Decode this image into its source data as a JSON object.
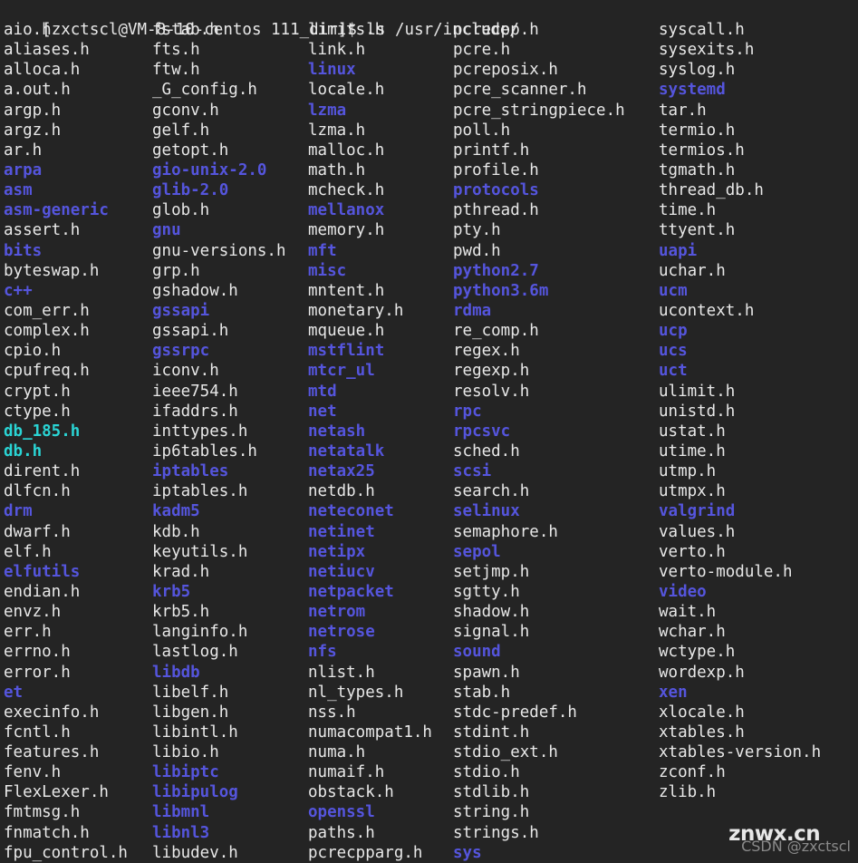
{
  "terminal": {
    "background_color": "#242424",
    "foreground_color": "#e8e8e8",
    "dir_color": "#5555dd",
    "link_color": "#2ad4d4",
    "prompt": {
      "user_host": "[zxctscl@VM-8-10-centos 111_dir]$",
      "command": "ls /usr/include/",
      "full": "[zxctscl@VM-8-10-centos 111_dir]$ ls /usr/include/"
    }
  },
  "watermark": {
    "main": "znwx.cn",
    "sub": "CSDN @zxctscl"
  },
  "listing": {
    "columns": [
      {
        "index": 1,
        "entries": [
          {
            "name": "aio.h",
            "type": "file"
          },
          {
            "name": "aliases.h",
            "type": "file"
          },
          {
            "name": "alloca.h",
            "type": "file"
          },
          {
            "name": "a.out.h",
            "type": "file"
          },
          {
            "name": "argp.h",
            "type": "file"
          },
          {
            "name": "argz.h",
            "type": "file"
          },
          {
            "name": "ar.h",
            "type": "file"
          },
          {
            "name": "arpa",
            "type": "dir"
          },
          {
            "name": "asm",
            "type": "dir"
          },
          {
            "name": "asm-generic",
            "type": "dir"
          },
          {
            "name": "assert.h",
            "type": "file"
          },
          {
            "name": "bits",
            "type": "dir"
          },
          {
            "name": "byteswap.h",
            "type": "file"
          },
          {
            "name": "c++",
            "type": "dir"
          },
          {
            "name": "com_err.h",
            "type": "file"
          },
          {
            "name": "complex.h",
            "type": "file"
          },
          {
            "name": "cpio.h",
            "type": "file"
          },
          {
            "name": "cpufreq.h",
            "type": "file"
          },
          {
            "name": "crypt.h",
            "type": "file"
          },
          {
            "name": "ctype.h",
            "type": "file"
          },
          {
            "name": "db_185.h",
            "type": "link"
          },
          {
            "name": "db.h",
            "type": "link"
          },
          {
            "name": "dirent.h",
            "type": "file"
          },
          {
            "name": "dlfcn.h",
            "type": "file"
          },
          {
            "name": "drm",
            "type": "dir"
          },
          {
            "name": "dwarf.h",
            "type": "file"
          },
          {
            "name": "elf.h",
            "type": "file"
          },
          {
            "name": "elfutils",
            "type": "dir"
          },
          {
            "name": "endian.h",
            "type": "file"
          },
          {
            "name": "envz.h",
            "type": "file"
          },
          {
            "name": "err.h",
            "type": "file"
          },
          {
            "name": "errno.h",
            "type": "file"
          },
          {
            "name": "error.h",
            "type": "file"
          },
          {
            "name": "et",
            "type": "dir"
          },
          {
            "name": "execinfo.h",
            "type": "file"
          },
          {
            "name": "fcntl.h",
            "type": "file"
          },
          {
            "name": "features.h",
            "type": "file"
          },
          {
            "name": "fenv.h",
            "type": "file"
          },
          {
            "name": "FlexLexer.h",
            "type": "file"
          },
          {
            "name": "fmtmsg.h",
            "type": "file"
          },
          {
            "name": "fnmatch.h",
            "type": "file"
          },
          {
            "name": "fpu_control.h",
            "type": "file"
          }
        ]
      },
      {
        "index": 2,
        "entries": [
          {
            "name": "fstab.h",
            "type": "file"
          },
          {
            "name": "fts.h",
            "type": "file"
          },
          {
            "name": "ftw.h",
            "type": "file"
          },
          {
            "name": "_G_config.h",
            "type": "file"
          },
          {
            "name": "gconv.h",
            "type": "file"
          },
          {
            "name": "gelf.h",
            "type": "file"
          },
          {
            "name": "getopt.h",
            "type": "file"
          },
          {
            "name": "gio-unix-2.0",
            "type": "dir"
          },
          {
            "name": "glib-2.0",
            "type": "dir"
          },
          {
            "name": "glob.h",
            "type": "file"
          },
          {
            "name": "gnu",
            "type": "dir"
          },
          {
            "name": "gnu-versions.h",
            "type": "file"
          },
          {
            "name": "grp.h",
            "type": "file"
          },
          {
            "name": "gshadow.h",
            "type": "file"
          },
          {
            "name": "gssapi",
            "type": "dir"
          },
          {
            "name": "gssapi.h",
            "type": "file"
          },
          {
            "name": "gssrpc",
            "type": "dir"
          },
          {
            "name": "iconv.h",
            "type": "file"
          },
          {
            "name": "ieee754.h",
            "type": "file"
          },
          {
            "name": "ifaddrs.h",
            "type": "file"
          },
          {
            "name": "inttypes.h",
            "type": "file"
          },
          {
            "name": "ip6tables.h",
            "type": "file"
          },
          {
            "name": "iptables",
            "type": "dir"
          },
          {
            "name": "iptables.h",
            "type": "file"
          },
          {
            "name": "kadm5",
            "type": "dir"
          },
          {
            "name": "kdb.h",
            "type": "file"
          },
          {
            "name": "keyutils.h",
            "type": "file"
          },
          {
            "name": "krad.h",
            "type": "file"
          },
          {
            "name": "krb5",
            "type": "dir"
          },
          {
            "name": "krb5.h",
            "type": "file"
          },
          {
            "name": "langinfo.h",
            "type": "file"
          },
          {
            "name": "lastlog.h",
            "type": "file"
          },
          {
            "name": "libdb",
            "type": "dir"
          },
          {
            "name": "libelf.h",
            "type": "file"
          },
          {
            "name": "libgen.h",
            "type": "file"
          },
          {
            "name": "libintl.h",
            "type": "file"
          },
          {
            "name": "libio.h",
            "type": "file"
          },
          {
            "name": "libiptc",
            "type": "dir"
          },
          {
            "name": "libipulog",
            "type": "dir"
          },
          {
            "name": "libmnl",
            "type": "dir"
          },
          {
            "name": "libnl3",
            "type": "dir"
          },
          {
            "name": "libudev.h",
            "type": "file"
          }
        ]
      },
      {
        "index": 3,
        "entries": [
          {
            "name": "limits.h",
            "type": "file"
          },
          {
            "name": "link.h",
            "type": "file"
          },
          {
            "name": "linux",
            "type": "dir"
          },
          {
            "name": "locale.h",
            "type": "file"
          },
          {
            "name": "lzma",
            "type": "dir"
          },
          {
            "name": "lzma.h",
            "type": "file"
          },
          {
            "name": "malloc.h",
            "type": "file"
          },
          {
            "name": "math.h",
            "type": "file"
          },
          {
            "name": "mcheck.h",
            "type": "file"
          },
          {
            "name": "mellanox",
            "type": "dir"
          },
          {
            "name": "memory.h",
            "type": "file"
          },
          {
            "name": "mft",
            "type": "dir"
          },
          {
            "name": "misc",
            "type": "dir"
          },
          {
            "name": "mntent.h",
            "type": "file"
          },
          {
            "name": "monetary.h",
            "type": "file"
          },
          {
            "name": "mqueue.h",
            "type": "file"
          },
          {
            "name": "mstflint",
            "type": "dir"
          },
          {
            "name": "mtcr_ul",
            "type": "dir"
          },
          {
            "name": "mtd",
            "type": "dir"
          },
          {
            "name": "net",
            "type": "dir"
          },
          {
            "name": "netash",
            "type": "dir"
          },
          {
            "name": "netatalk",
            "type": "dir"
          },
          {
            "name": "netax25",
            "type": "dir"
          },
          {
            "name": "netdb.h",
            "type": "file"
          },
          {
            "name": "neteconet",
            "type": "dir"
          },
          {
            "name": "netinet",
            "type": "dir"
          },
          {
            "name": "netipx",
            "type": "dir"
          },
          {
            "name": "netiucv",
            "type": "dir"
          },
          {
            "name": "netpacket",
            "type": "dir"
          },
          {
            "name": "netrom",
            "type": "dir"
          },
          {
            "name": "netrose",
            "type": "dir"
          },
          {
            "name": "nfs",
            "type": "dir"
          },
          {
            "name": "nlist.h",
            "type": "file"
          },
          {
            "name": "nl_types.h",
            "type": "file"
          },
          {
            "name": "nss.h",
            "type": "file"
          },
          {
            "name": "numacompat1.h",
            "type": "file"
          },
          {
            "name": "numa.h",
            "type": "file"
          },
          {
            "name": "numaif.h",
            "type": "file"
          },
          {
            "name": "obstack.h",
            "type": "file"
          },
          {
            "name": "openssl",
            "type": "dir"
          },
          {
            "name": "paths.h",
            "type": "file"
          },
          {
            "name": "pcrecpparg.h",
            "type": "file"
          }
        ]
      },
      {
        "index": 4,
        "entries": [
          {
            "name": "pcrecpp.h",
            "type": "file"
          },
          {
            "name": "pcre.h",
            "type": "file"
          },
          {
            "name": "pcreposix.h",
            "type": "file"
          },
          {
            "name": "pcre_scanner.h",
            "type": "file"
          },
          {
            "name": "pcre_stringpiece.h",
            "type": "file"
          },
          {
            "name": "poll.h",
            "type": "file"
          },
          {
            "name": "printf.h",
            "type": "file"
          },
          {
            "name": "profile.h",
            "type": "file"
          },
          {
            "name": "protocols",
            "type": "dir"
          },
          {
            "name": "pthread.h",
            "type": "file"
          },
          {
            "name": "pty.h",
            "type": "file"
          },
          {
            "name": "pwd.h",
            "type": "file"
          },
          {
            "name": "python2.7",
            "type": "dir"
          },
          {
            "name": "python3.6m",
            "type": "dir"
          },
          {
            "name": "rdma",
            "type": "dir"
          },
          {
            "name": "re_comp.h",
            "type": "file"
          },
          {
            "name": "regex.h",
            "type": "file"
          },
          {
            "name": "regexp.h",
            "type": "file"
          },
          {
            "name": "resolv.h",
            "type": "file"
          },
          {
            "name": "rpc",
            "type": "dir"
          },
          {
            "name": "rpcsvc",
            "type": "dir"
          },
          {
            "name": "sched.h",
            "type": "file"
          },
          {
            "name": "scsi",
            "type": "dir"
          },
          {
            "name": "search.h",
            "type": "file"
          },
          {
            "name": "selinux",
            "type": "dir"
          },
          {
            "name": "semaphore.h",
            "type": "file"
          },
          {
            "name": "sepol",
            "type": "dir"
          },
          {
            "name": "setjmp.h",
            "type": "file"
          },
          {
            "name": "sgtty.h",
            "type": "file"
          },
          {
            "name": "shadow.h",
            "type": "file"
          },
          {
            "name": "signal.h",
            "type": "file"
          },
          {
            "name": "sound",
            "type": "dir"
          },
          {
            "name": "spawn.h",
            "type": "file"
          },
          {
            "name": "stab.h",
            "type": "file"
          },
          {
            "name": "stdc-predef.h",
            "type": "file"
          },
          {
            "name": "stdint.h",
            "type": "file"
          },
          {
            "name": "stdio_ext.h",
            "type": "file"
          },
          {
            "name": "stdio.h",
            "type": "file"
          },
          {
            "name": "stdlib.h",
            "type": "file"
          },
          {
            "name": "string.h",
            "type": "file"
          },
          {
            "name": "strings.h",
            "type": "file"
          },
          {
            "name": "sys",
            "type": "dir"
          }
        ]
      },
      {
        "index": 5,
        "entries": [
          {
            "name": "syscall.h",
            "type": "file"
          },
          {
            "name": "sysexits.h",
            "type": "file"
          },
          {
            "name": "syslog.h",
            "type": "file"
          },
          {
            "name": "systemd",
            "type": "dir"
          },
          {
            "name": "tar.h",
            "type": "file"
          },
          {
            "name": "termio.h",
            "type": "file"
          },
          {
            "name": "termios.h",
            "type": "file"
          },
          {
            "name": "tgmath.h",
            "type": "file"
          },
          {
            "name": "thread_db.h",
            "type": "file"
          },
          {
            "name": "time.h",
            "type": "file"
          },
          {
            "name": "ttyent.h",
            "type": "file"
          },
          {
            "name": "uapi",
            "type": "dir"
          },
          {
            "name": "uchar.h",
            "type": "file"
          },
          {
            "name": "ucm",
            "type": "dir"
          },
          {
            "name": "ucontext.h",
            "type": "file"
          },
          {
            "name": "ucp",
            "type": "dir"
          },
          {
            "name": "ucs",
            "type": "dir"
          },
          {
            "name": "uct",
            "type": "dir"
          },
          {
            "name": "ulimit.h",
            "type": "file"
          },
          {
            "name": "unistd.h",
            "type": "file"
          },
          {
            "name": "ustat.h",
            "type": "file"
          },
          {
            "name": "utime.h",
            "type": "file"
          },
          {
            "name": "utmp.h",
            "type": "file"
          },
          {
            "name": "utmpx.h",
            "type": "file"
          },
          {
            "name": "valgrind",
            "type": "dir"
          },
          {
            "name": "values.h",
            "type": "file"
          },
          {
            "name": "verto.h",
            "type": "file"
          },
          {
            "name": "verto-module.h",
            "type": "file"
          },
          {
            "name": "video",
            "type": "dir"
          },
          {
            "name": "wait.h",
            "type": "file"
          },
          {
            "name": "wchar.h",
            "type": "file"
          },
          {
            "name": "wctype.h",
            "type": "file"
          },
          {
            "name": "wordexp.h",
            "type": "file"
          },
          {
            "name": "xen",
            "type": "dir"
          },
          {
            "name": "xlocale.h",
            "type": "file"
          },
          {
            "name": "xtables.h",
            "type": "file"
          },
          {
            "name": "xtables-version.h",
            "type": "file"
          },
          {
            "name": "zconf.h",
            "type": "file"
          },
          {
            "name": "zlib.h",
            "type": "file"
          }
        ]
      }
    ]
  }
}
